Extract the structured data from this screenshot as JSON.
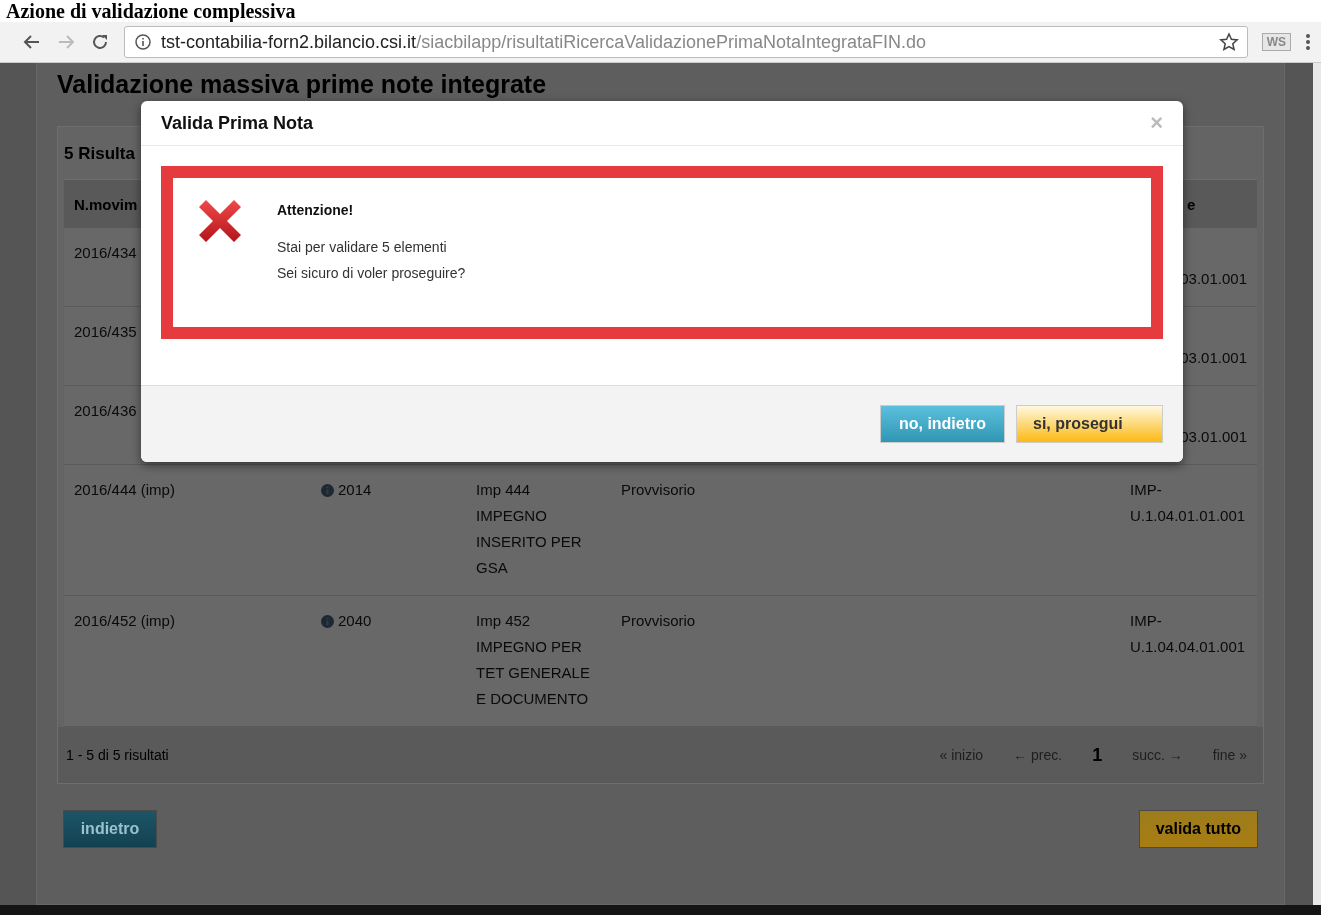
{
  "page_heading": "Azione di validazione complessiva",
  "browser": {
    "url_host": "tst-contabilia-forn2.bilancio.csi.it",
    "url_path": "/siacbilapp/risultatiRicercaValidazionePrimaNotaIntegrataFIN.do",
    "extension_label": "WS"
  },
  "page": {
    "title": "Validazione massiva prime note integrate",
    "results_heading": "5 Risulta",
    "table": {
      "header": {
        "column_1": "N.movim",
        "column_5": "e"
      },
      "rows": [
        {
          "column_1": "2016/434",
          "column_5": "03.01.001"
        },
        {
          "column_1": "2016/435",
          "column_5": "03.01.001"
        },
        {
          "column_1": "2016/436",
          "column_5": "03.01.001"
        },
        {
          "column_1": "2016/444 (imp)",
          "column_2": "2014",
          "column_3": "Imp 444 IMPEGNO INSERITO PER GSA",
          "column_4": "Provvisorio",
          "column_5": "IMP-U.1.04.01.01.001"
        },
        {
          "column_1": "2016/452 (imp)",
          "column_2": "2040",
          "column_3": "Imp 452 IMPEGNO PER TET GENERALE E DOCUMENTO",
          "column_4": "Provvisorio",
          "column_5": "IMP-U.1.04.04.01.001"
        }
      ]
    },
    "summary": "1 - 5 di 5 risultati",
    "pagination": [
      {
        "label": "« inizio",
        "selected": false
      },
      {
        "label": "← prec.",
        "selected": false
      },
      {
        "label": "1",
        "selected": true
      },
      {
        "label": "succ. →",
        "selected": false
      },
      {
        "label": "fine »",
        "selected": false
      }
    ],
    "buttons": [
      {
        "label": "indietro",
        "kind": "secondary"
      },
      {
        "label": "valida tutto",
        "kind": "primary"
      }
    ]
  },
  "modal": {
    "title": "Valida Prima Nota",
    "close": "×",
    "alert": {
      "title": "Attenzione!",
      "lines": [
        "Stai per validare 5 elementi",
        "Sei sicuro di voler proseguire?"
      ]
    },
    "buttons": [
      {
        "label": "no, indietro",
        "kind": "secondary"
      },
      {
        "label": "si, prosegui",
        "kind": "primary"
      }
    ]
  }
}
